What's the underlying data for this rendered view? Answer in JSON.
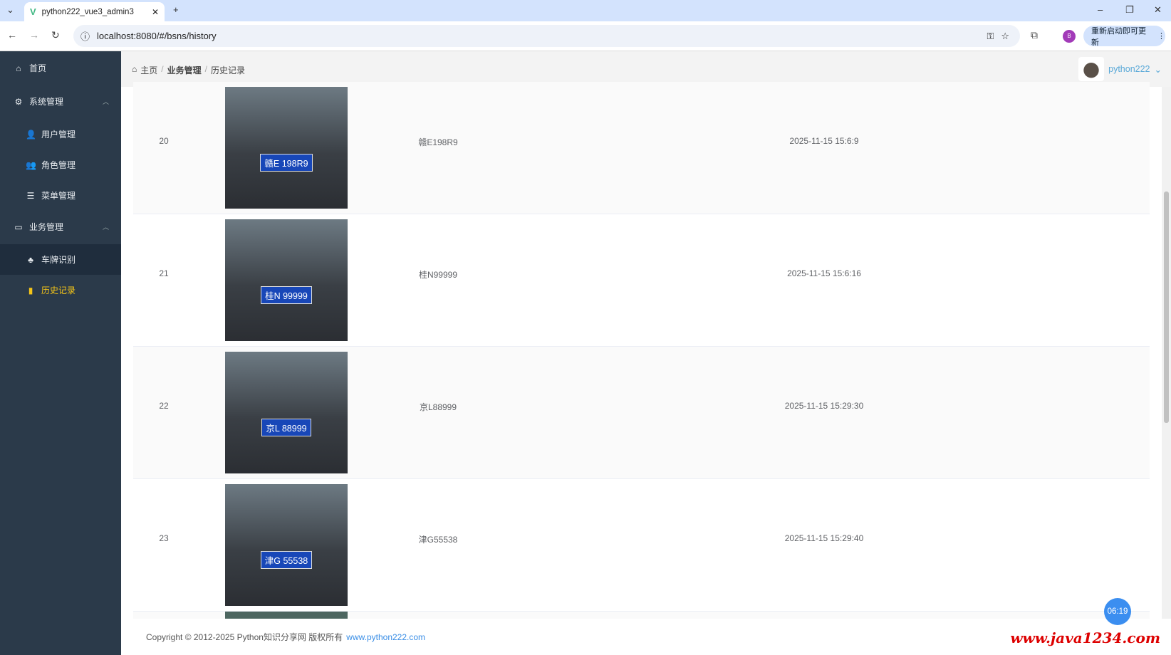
{
  "browser": {
    "tab_title": "python222_vue3_admin3",
    "url": "localhost:8080/#/bsns/history",
    "update_label": "重新启动即可更新",
    "profile_initial": "B"
  },
  "sidebar": {
    "items": [
      {
        "label": "首页",
        "icon": "home-icon"
      },
      {
        "label": "系统管理",
        "icon": "gear-icon"
      },
      {
        "label": "用户管理",
        "icon": "user-icon"
      },
      {
        "label": "角色管理",
        "icon": "users-icon"
      },
      {
        "label": "菜单管理",
        "icon": "menu-tree-icon"
      },
      {
        "label": "业务管理",
        "icon": "monitor-icon"
      },
      {
        "label": "车牌识别",
        "icon": "sitemap-icon"
      },
      {
        "label": "历史记录",
        "icon": "history-icon"
      }
    ]
  },
  "header": {
    "breadcrumb": [
      "主页",
      "业务管理",
      "历史记录"
    ],
    "username": "python222"
  },
  "table": {
    "rows": [
      {
        "index": "20",
        "plate": "赣E198R9",
        "time": "2025-11-15 15:6:9",
        "image_plate": "赣E 198R9"
      },
      {
        "index": "21",
        "plate": "桂N99999",
        "time": "2025-11-15 15:6:16",
        "image_plate": "桂N 99999"
      },
      {
        "index": "22",
        "plate": "京L88999",
        "time": "2025-11-15 15:29:30",
        "image_plate": "京L 88999"
      },
      {
        "index": "23",
        "plate": "津G55538",
        "time": "2025-11-15 15:29:40",
        "image_plate": "津G 55538"
      }
    ]
  },
  "footer": {
    "copyright": "Copyright © 2012-2025 Python知识分享网 版权所有",
    "link": "www.python222.com"
  },
  "overlay": {
    "timer": "06:19",
    "watermark": "www.java1234.com"
  }
}
